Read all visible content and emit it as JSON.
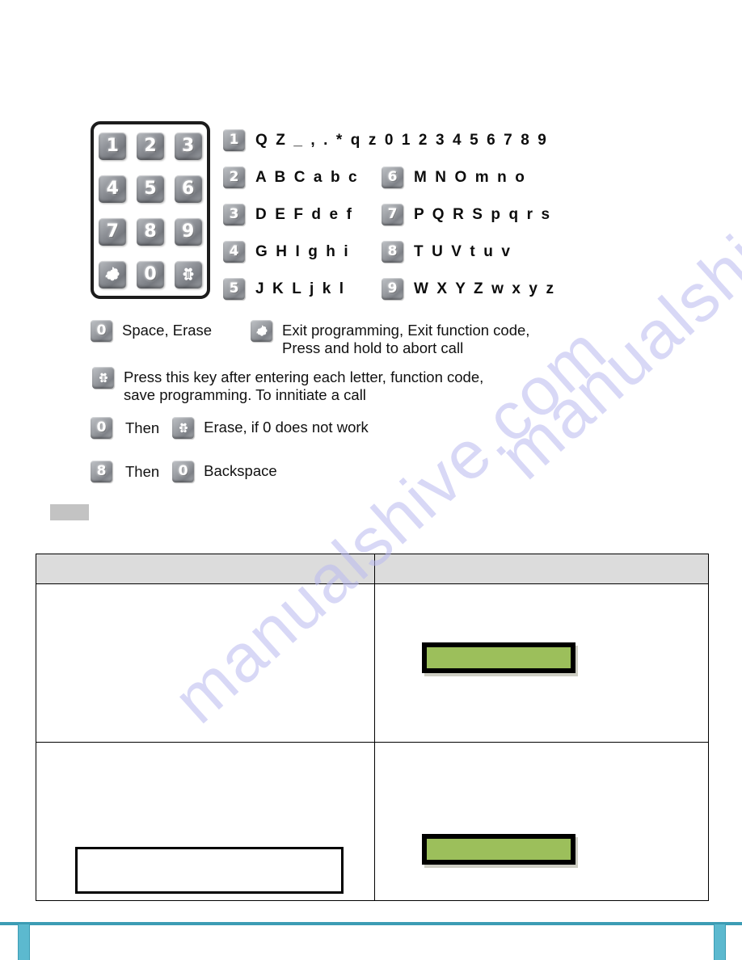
{
  "keypad": {
    "keys": [
      {
        "symbol": "1",
        "name": "keypad-key-1"
      },
      {
        "symbol": "2",
        "name": "keypad-key-2"
      },
      {
        "symbol": "3",
        "name": "keypad-key-3"
      },
      {
        "symbol": "4",
        "name": "keypad-key-4"
      },
      {
        "symbol": "5",
        "name": "keypad-key-5"
      },
      {
        "symbol": "6",
        "name": "keypad-key-6"
      },
      {
        "symbol": "7",
        "name": "keypad-key-7"
      },
      {
        "symbol": "8",
        "name": "keypad-key-8"
      },
      {
        "symbol": "9",
        "name": "keypad-key-9"
      },
      {
        "symbol": "*",
        "name": "keypad-key-star"
      },
      {
        "symbol": "0",
        "name": "keypad-key-0"
      },
      {
        "symbol": "#",
        "name": "keypad-key-pound"
      }
    ]
  },
  "char_map": {
    "rows": [
      {
        "left": {
          "key": "1",
          "chars": "Q Z _ , . * q z 0 1 2 3 4 5 6 7 8 9"
        },
        "right": null
      },
      {
        "left": {
          "key": "2",
          "chars": "A B C a b c"
        },
        "right": {
          "key": "6",
          "chars": "M N O m n o"
        }
      },
      {
        "left": {
          "key": "3",
          "chars": "D E F d e f"
        },
        "right": {
          "key": "7",
          "chars": "P Q R S p q r s"
        }
      },
      {
        "left": {
          "key": "4",
          "chars": "G H I g h i"
        },
        "right": {
          "key": "8",
          "chars": "T U V t u v"
        }
      },
      {
        "left": {
          "key": "5",
          "chars": "J K L j k l"
        },
        "right": {
          "key": "9",
          "chars": "W X Y Z w x y z"
        }
      }
    ]
  },
  "legend": {
    "zero_space_erase": {
      "key": "0",
      "text": "Space, Erase"
    },
    "star_exit": {
      "key": "*",
      "text": "Exit programming, Exit function code,\nPress and hold to abort call"
    },
    "pound_confirm": {
      "key": "#",
      "text": "Press this key after entering each letter, function code,\nsave programming. To innitiate a call"
    },
    "erase_combo": {
      "key_first": "0",
      "connector": "Then",
      "key_second": "#",
      "text": "Erase, if 0 does not work"
    },
    "backspace_combo": {
      "key_first": "8",
      "connector": "Then",
      "key_second": "0",
      "text": "Backspace"
    }
  },
  "redacted_block": {
    "label": ""
  },
  "table": {
    "headers": [
      "",
      ""
    ],
    "rows": [
      {
        "left_cell": "",
        "right_cell": "",
        "lcd_text": ""
      },
      {
        "left_cell": "",
        "note_box": "",
        "right_cell": "",
        "lcd_text": ""
      }
    ]
  },
  "colors": {
    "lcd_green": "#9cbf5b",
    "table_header_gray": "#dcdcdc",
    "redacted_gray": "#c3c3c3",
    "footer_teal": "#3c9cb4",
    "footer_tab_teal": "#5cb9cf",
    "watermark": "#babaf0"
  },
  "watermark": {
    "line_a": "manualshive.com",
    "line_b": "manualshive.com"
  }
}
